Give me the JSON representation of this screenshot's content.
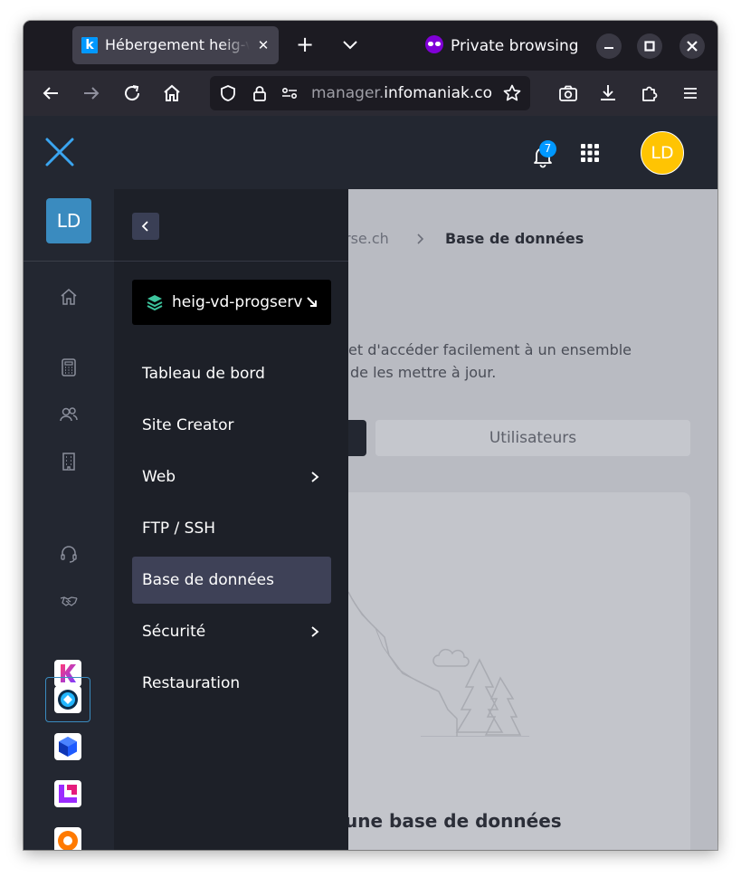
{
  "browser": {
    "tab_title": "Hébergement heig-vd",
    "private_label": "Private browsing",
    "url_prefix": "manager.",
    "url_domain": "infomaniak.co"
  },
  "header": {
    "notification_count": "7",
    "user_initials": "LD"
  },
  "rail": {
    "account_initials": "LD"
  },
  "submenu": {
    "site_name": "heig-vd-progserv",
    "items": [
      {
        "label": "Tableau de bord",
        "has_children": false,
        "active": false
      },
      {
        "label": "Site Creator",
        "has_children": false,
        "active": false
      },
      {
        "label": "Web",
        "has_children": true,
        "active": false
      },
      {
        "label": "FTP / SSH",
        "has_children": false,
        "active": false
      },
      {
        "label": "Base de données",
        "has_children": false,
        "active": true
      },
      {
        "label": "Sécurité",
        "has_children": true,
        "active": false
      },
      {
        "label": "Restauration",
        "has_children": false,
        "active": false
      }
    ]
  },
  "content": {
    "breadcrumb_prev": "rse.ch",
    "breadcrumb_current": "Base de données",
    "description_line1": "et d'accéder facilement à un ensemble",
    "description_line2": "de les mettre à jour.",
    "tab_users": "Utilisateurs",
    "empty_title": "une base de données"
  },
  "colors": {
    "accent_blue": "#0098ff",
    "avatar_yellow": "#ffc403",
    "active_menu": "#3e4157",
    "private_purple": "#8000d7"
  }
}
